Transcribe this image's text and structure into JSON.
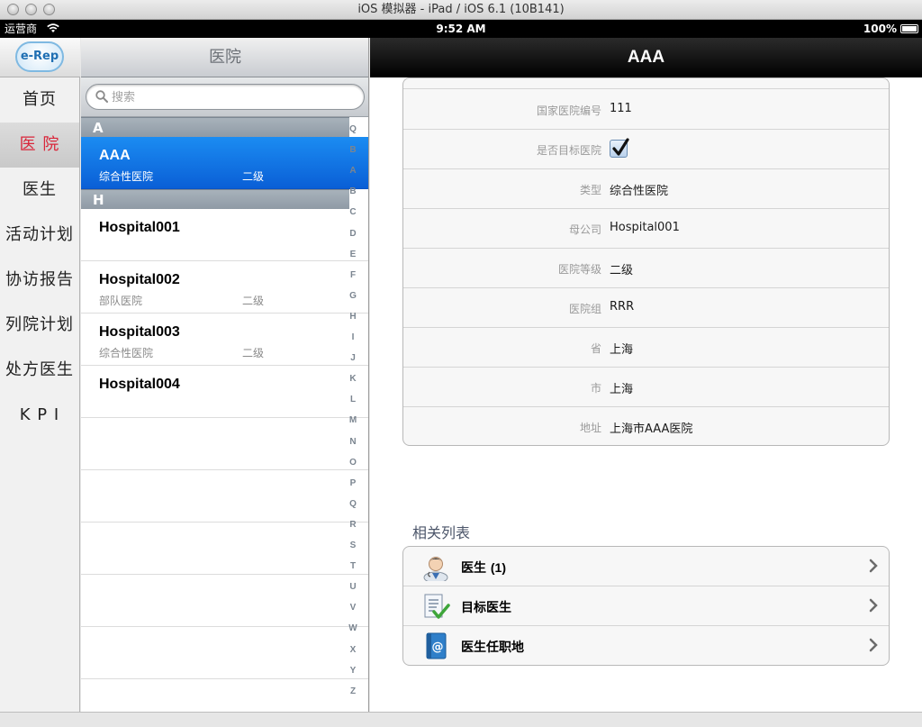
{
  "window": {
    "title": "iOS 模拟器 - iPad / iOS 6.1 (10B141)"
  },
  "statusbar": {
    "carrier": "运营商",
    "time": "9:52 AM",
    "battery": "100%"
  },
  "nav": {
    "logo": "e-Rep",
    "items": [
      {
        "label": "首页"
      },
      {
        "label": "医 院",
        "active": true
      },
      {
        "label": "医生"
      },
      {
        "label": "活动计划"
      },
      {
        "label": "协访报告"
      },
      {
        "label": "列院计划"
      },
      {
        "label": "处方医生"
      },
      {
        "label": "K P I"
      }
    ]
  },
  "list": {
    "title": "医院",
    "search_placeholder": "搜索",
    "sections": [
      {
        "letter": "A"
      },
      {
        "letter": "H"
      }
    ],
    "rows": [
      {
        "name": "AAA",
        "type": "综合性医院",
        "level": "二级",
        "selected": true
      },
      {
        "name": "Hospital001",
        "type": "",
        "level": ""
      },
      {
        "name": "Hospital002",
        "type": "部队医院",
        "level": "二级"
      },
      {
        "name": "Hospital003",
        "type": "综合性医院",
        "level": "二级"
      },
      {
        "name": "Hospital004",
        "type": "",
        "level": ""
      }
    ],
    "index": [
      "Q",
      "B",
      "A",
      "B",
      "C",
      "D",
      "E",
      "F",
      "G",
      "H",
      "I",
      "J",
      "K",
      "L",
      "M",
      "N",
      "O",
      "P",
      "Q",
      "R",
      "S",
      "T",
      "U",
      "V",
      "W",
      "X",
      "Y",
      "Z"
    ]
  },
  "detail": {
    "title": "AAA",
    "fields": [
      {
        "label": "国家医院编号",
        "value": "111"
      },
      {
        "label": "是否目标医院",
        "value": "",
        "checked": true
      },
      {
        "label": "类型",
        "value": "综合性医院"
      },
      {
        "label": "母公司",
        "value": "Hospital001"
      },
      {
        "label": "医院等级",
        "value": "二级"
      },
      {
        "label": "医院组",
        "value": "RRR"
      },
      {
        "label": "省",
        "value": "上海"
      },
      {
        "label": "市",
        "value": "上海"
      },
      {
        "label": "地址",
        "value": "上海市AAA医院"
      }
    ],
    "related_title": "相关列表",
    "related": [
      {
        "label": "医生",
        "count": "(1)",
        "icon": "doctor-icon"
      },
      {
        "label": "目标医生",
        "count": "",
        "icon": "checklist-icon"
      },
      {
        "label": "医生任职地",
        "count": "",
        "icon": "address-book-icon"
      }
    ]
  }
}
